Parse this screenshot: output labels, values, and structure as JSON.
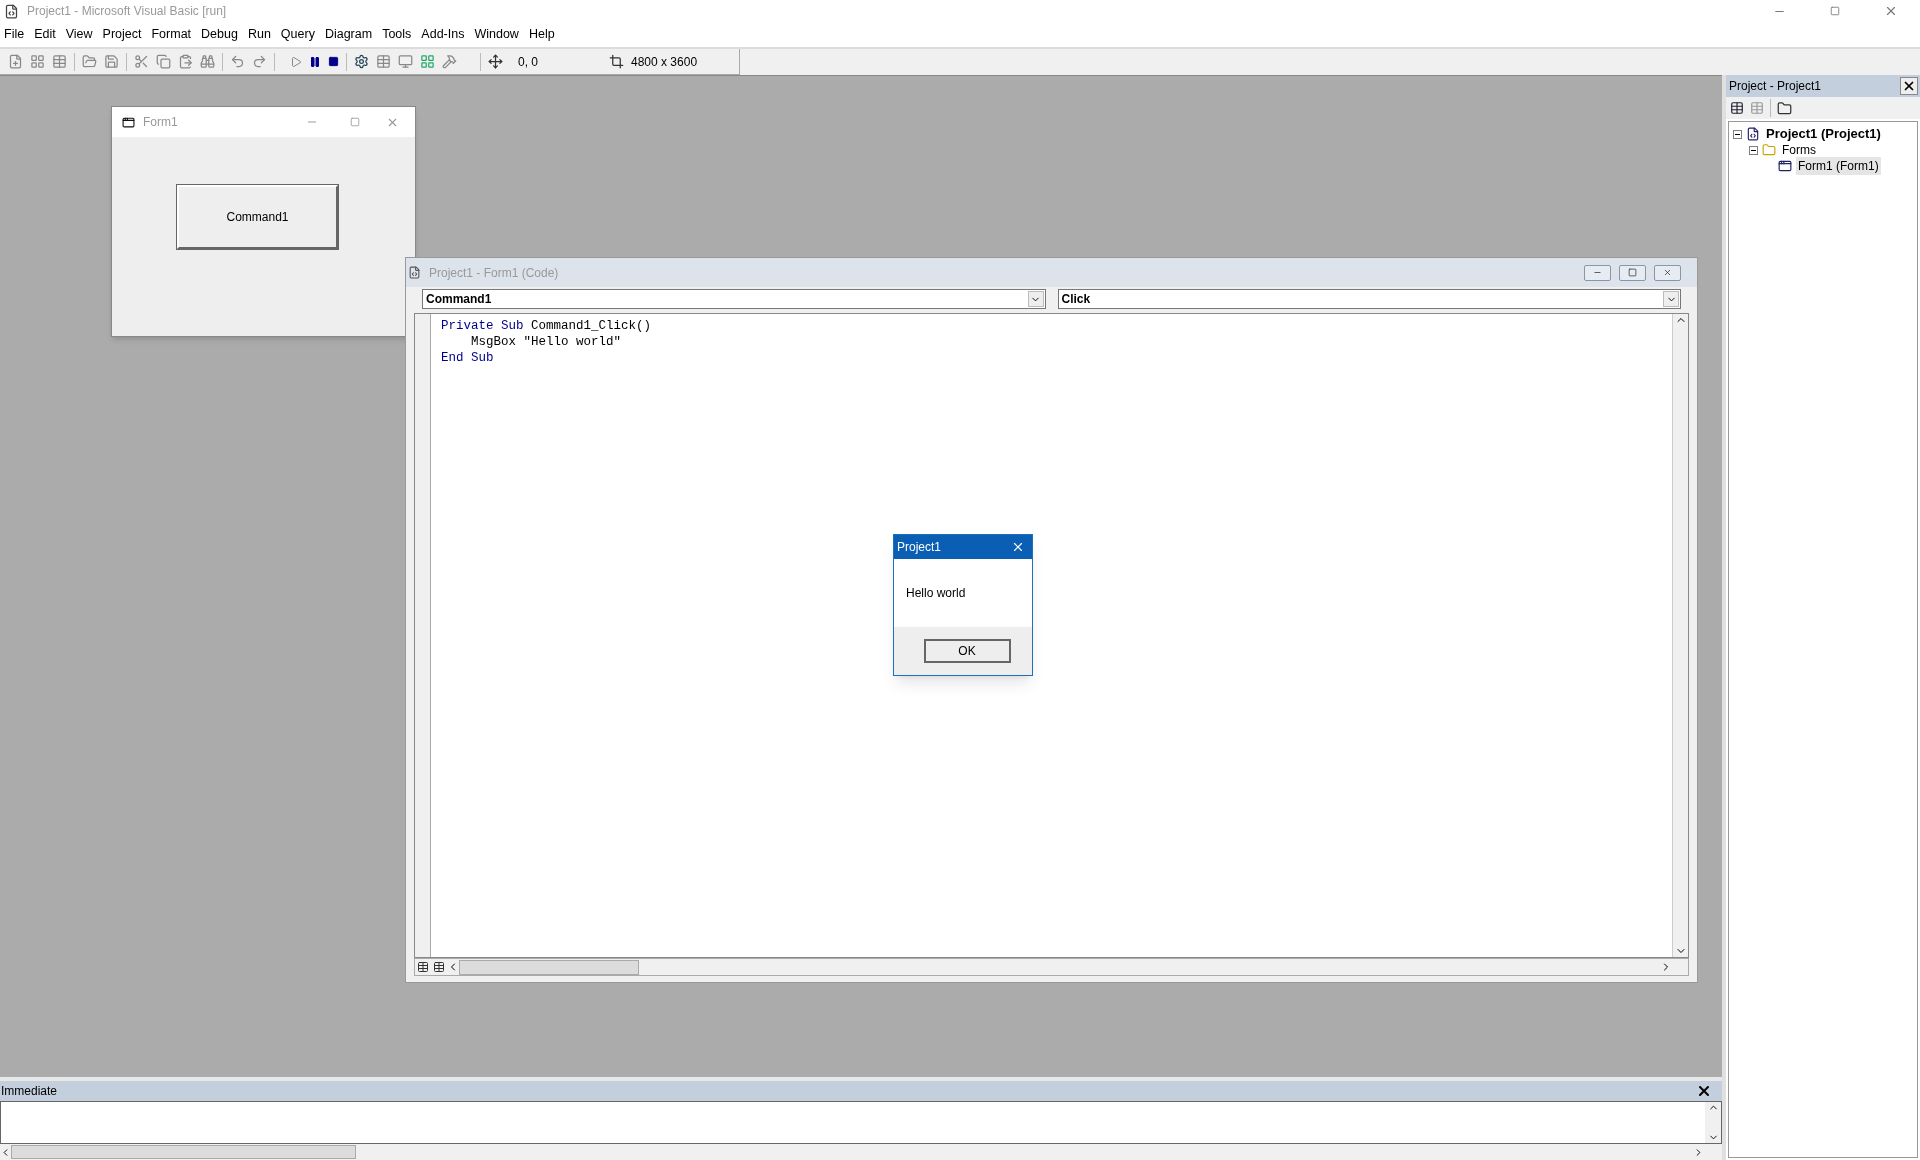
{
  "app_window": {
    "title": "Project1 - Microsoft Visual Basic [run]"
  },
  "menu": [
    {
      "label": "File"
    },
    {
      "label": "Edit"
    },
    {
      "label": "View"
    },
    {
      "label": "Project"
    },
    {
      "label": "Format"
    },
    {
      "label": "Debug"
    },
    {
      "label": "Run"
    },
    {
      "label": "Query"
    },
    {
      "label": "Diagram"
    },
    {
      "label": "Tools"
    },
    {
      "label": "Add-Ins"
    },
    {
      "label": "Window"
    },
    {
      "label": "Help"
    }
  ],
  "toolbar": {
    "position": "0, 0",
    "size": "4800 x 3600"
  },
  "form_window": {
    "title": "Form1",
    "button": "Command1"
  },
  "code_window": {
    "title": "Project1 - Form1 (Code)",
    "object": "Command1",
    "procedure": "Click",
    "lines": [
      [
        {
          "kind": "keyword",
          "text": "Private Sub"
        },
        {
          "kind": "plain",
          "text": " Command1_Click()"
        }
      ],
      [
        {
          "kind": "plain",
          "text": "    MsgBox \"Hello world\""
        }
      ],
      [
        {
          "kind": "keyword",
          "text": "End Sub"
        }
      ]
    ]
  },
  "message_box": {
    "title": "Project1",
    "message": "Hello world",
    "button": "OK"
  },
  "project_explorer": {
    "title": "Project - Project1",
    "tree": [
      {
        "kind": "project",
        "label": "Project1 (Project1)",
        "expanded": true,
        "selected": false,
        "children": [
          {
            "kind": "folder",
            "label": "Forms",
            "expanded": true,
            "selected": false,
            "children": [
              {
                "kind": "form",
                "label": "Form1 (Form1)",
                "selected": true
              }
            ]
          }
        ]
      }
    ]
  },
  "immediate": {
    "title": "Immediate"
  }
}
